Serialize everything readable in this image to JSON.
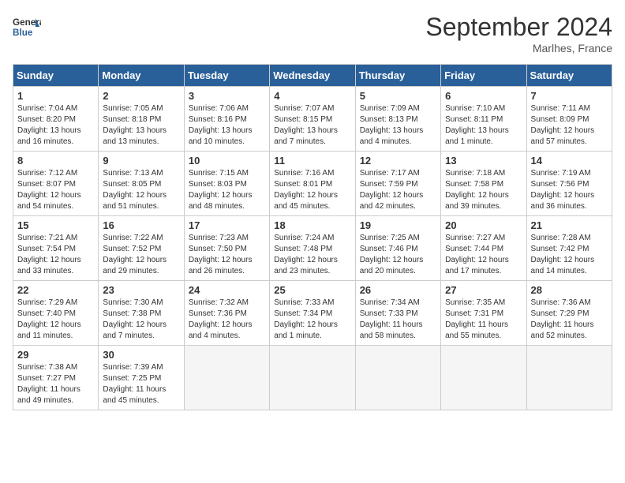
{
  "header": {
    "logo_line1": "General",
    "logo_line2": "Blue",
    "month_title": "September 2024",
    "location": "Marlhes, France"
  },
  "weekdays": [
    "Sunday",
    "Monday",
    "Tuesday",
    "Wednesday",
    "Thursday",
    "Friday",
    "Saturday"
  ],
  "weeks": [
    [
      {
        "day": "1",
        "info": "Sunrise: 7:04 AM\nSunset: 8:20 PM\nDaylight: 13 hours\nand 16 minutes."
      },
      {
        "day": "2",
        "info": "Sunrise: 7:05 AM\nSunset: 8:18 PM\nDaylight: 13 hours\nand 13 minutes."
      },
      {
        "day": "3",
        "info": "Sunrise: 7:06 AM\nSunset: 8:16 PM\nDaylight: 13 hours\nand 10 minutes."
      },
      {
        "day": "4",
        "info": "Sunrise: 7:07 AM\nSunset: 8:15 PM\nDaylight: 13 hours\nand 7 minutes."
      },
      {
        "day": "5",
        "info": "Sunrise: 7:09 AM\nSunset: 8:13 PM\nDaylight: 13 hours\nand 4 minutes."
      },
      {
        "day": "6",
        "info": "Sunrise: 7:10 AM\nSunset: 8:11 PM\nDaylight: 13 hours\nand 1 minute."
      },
      {
        "day": "7",
        "info": "Sunrise: 7:11 AM\nSunset: 8:09 PM\nDaylight: 12 hours\nand 57 minutes."
      }
    ],
    [
      {
        "day": "8",
        "info": "Sunrise: 7:12 AM\nSunset: 8:07 PM\nDaylight: 12 hours\nand 54 minutes."
      },
      {
        "day": "9",
        "info": "Sunrise: 7:13 AM\nSunset: 8:05 PM\nDaylight: 12 hours\nand 51 minutes."
      },
      {
        "day": "10",
        "info": "Sunrise: 7:15 AM\nSunset: 8:03 PM\nDaylight: 12 hours\nand 48 minutes."
      },
      {
        "day": "11",
        "info": "Sunrise: 7:16 AM\nSunset: 8:01 PM\nDaylight: 12 hours\nand 45 minutes."
      },
      {
        "day": "12",
        "info": "Sunrise: 7:17 AM\nSunset: 7:59 PM\nDaylight: 12 hours\nand 42 minutes."
      },
      {
        "day": "13",
        "info": "Sunrise: 7:18 AM\nSunset: 7:58 PM\nDaylight: 12 hours\nand 39 minutes."
      },
      {
        "day": "14",
        "info": "Sunrise: 7:19 AM\nSunset: 7:56 PM\nDaylight: 12 hours\nand 36 minutes."
      }
    ],
    [
      {
        "day": "15",
        "info": "Sunrise: 7:21 AM\nSunset: 7:54 PM\nDaylight: 12 hours\nand 33 minutes."
      },
      {
        "day": "16",
        "info": "Sunrise: 7:22 AM\nSunset: 7:52 PM\nDaylight: 12 hours\nand 29 minutes."
      },
      {
        "day": "17",
        "info": "Sunrise: 7:23 AM\nSunset: 7:50 PM\nDaylight: 12 hours\nand 26 minutes."
      },
      {
        "day": "18",
        "info": "Sunrise: 7:24 AM\nSunset: 7:48 PM\nDaylight: 12 hours\nand 23 minutes."
      },
      {
        "day": "19",
        "info": "Sunrise: 7:25 AM\nSunset: 7:46 PM\nDaylight: 12 hours\nand 20 minutes."
      },
      {
        "day": "20",
        "info": "Sunrise: 7:27 AM\nSunset: 7:44 PM\nDaylight: 12 hours\nand 17 minutes."
      },
      {
        "day": "21",
        "info": "Sunrise: 7:28 AM\nSunset: 7:42 PM\nDaylight: 12 hours\nand 14 minutes."
      }
    ],
    [
      {
        "day": "22",
        "info": "Sunrise: 7:29 AM\nSunset: 7:40 PM\nDaylight: 12 hours\nand 11 minutes."
      },
      {
        "day": "23",
        "info": "Sunrise: 7:30 AM\nSunset: 7:38 PM\nDaylight: 12 hours\nand 7 minutes."
      },
      {
        "day": "24",
        "info": "Sunrise: 7:32 AM\nSunset: 7:36 PM\nDaylight: 12 hours\nand 4 minutes."
      },
      {
        "day": "25",
        "info": "Sunrise: 7:33 AM\nSunset: 7:34 PM\nDaylight: 12 hours\nand 1 minute."
      },
      {
        "day": "26",
        "info": "Sunrise: 7:34 AM\nSunset: 7:33 PM\nDaylight: 11 hours\nand 58 minutes."
      },
      {
        "day": "27",
        "info": "Sunrise: 7:35 AM\nSunset: 7:31 PM\nDaylight: 11 hours\nand 55 minutes."
      },
      {
        "day": "28",
        "info": "Sunrise: 7:36 AM\nSunset: 7:29 PM\nDaylight: 11 hours\nand 52 minutes."
      }
    ],
    [
      {
        "day": "29",
        "info": "Sunrise: 7:38 AM\nSunset: 7:27 PM\nDaylight: 11 hours\nand 49 minutes."
      },
      {
        "day": "30",
        "info": "Sunrise: 7:39 AM\nSunset: 7:25 PM\nDaylight: 11 hours\nand 45 minutes."
      },
      null,
      null,
      null,
      null,
      null
    ]
  ]
}
